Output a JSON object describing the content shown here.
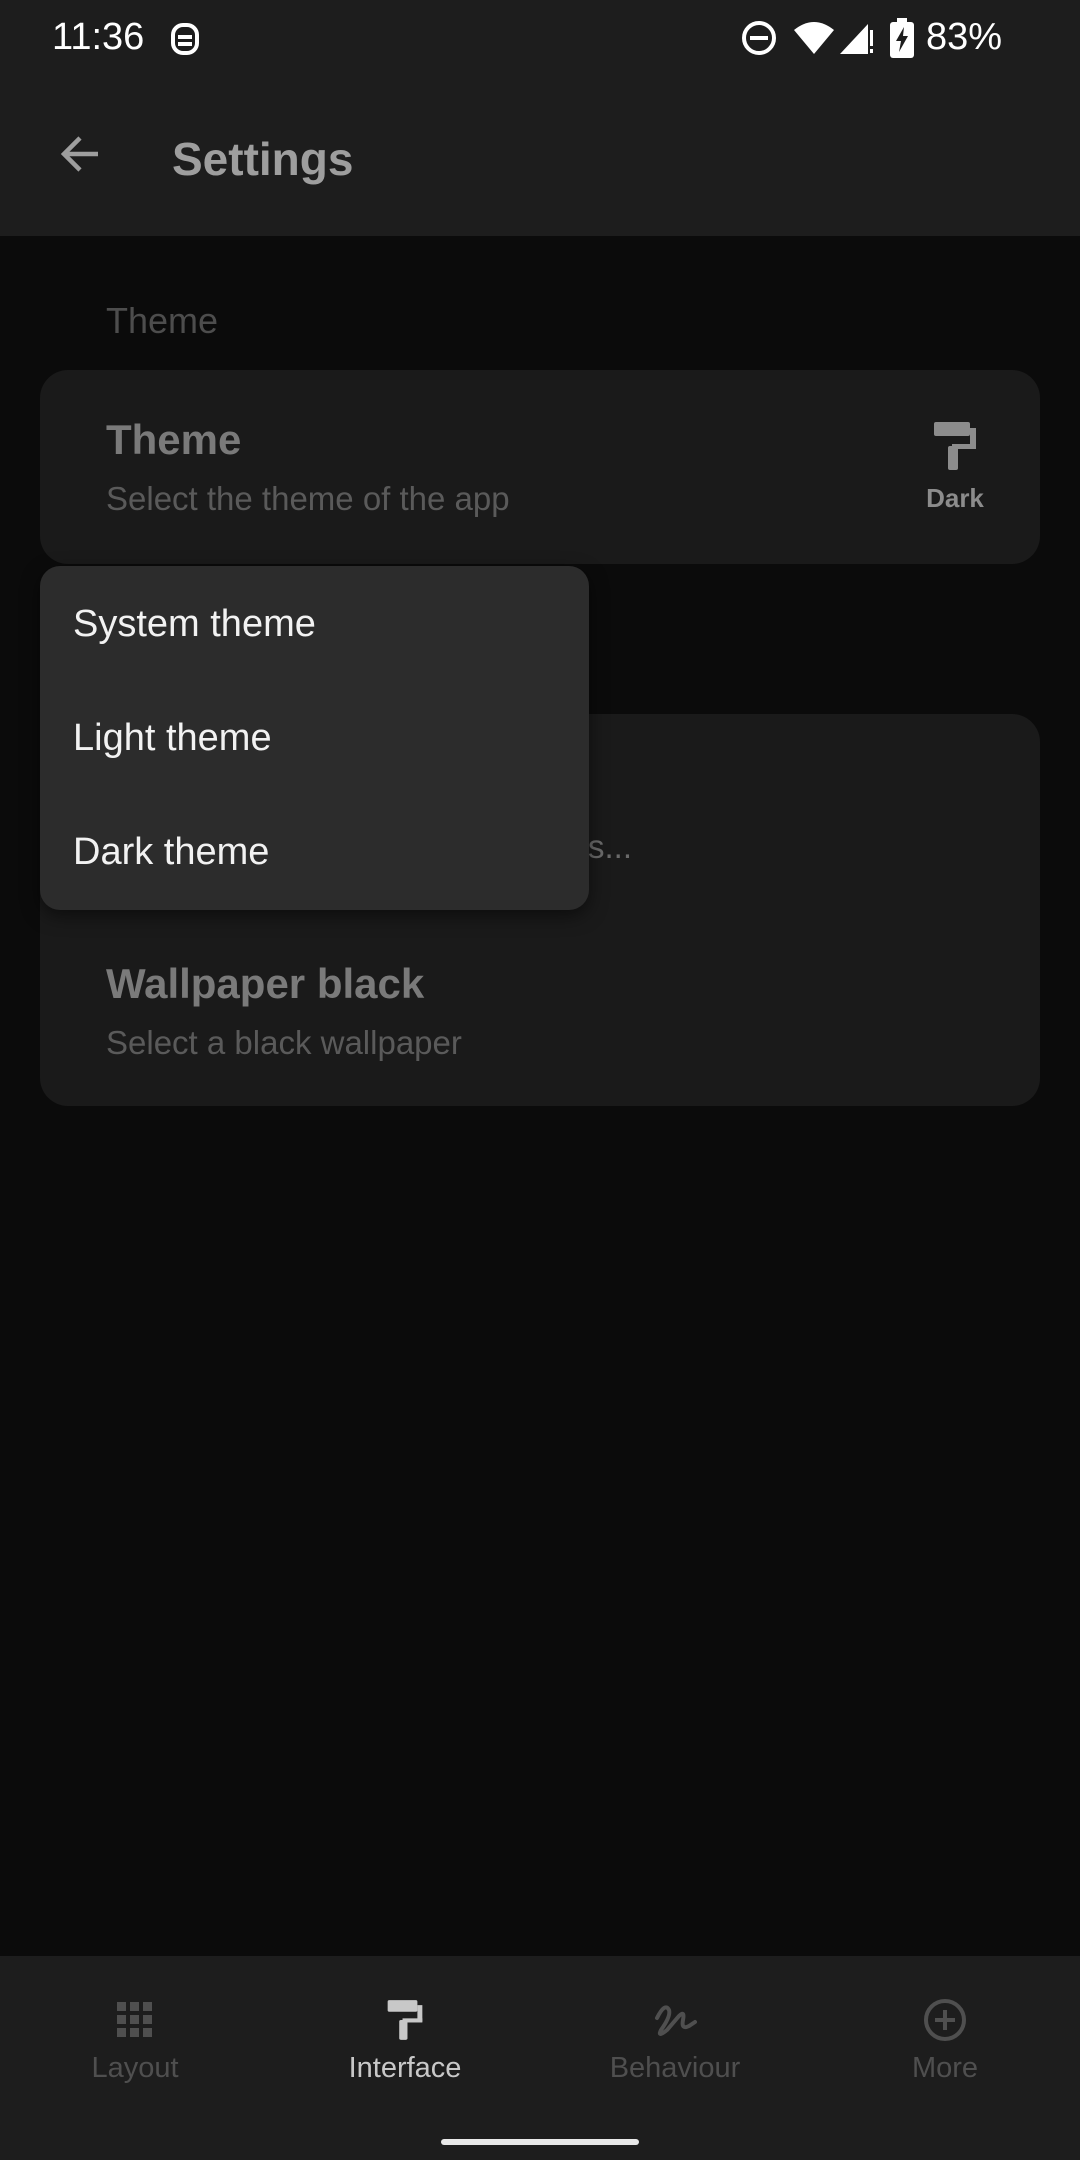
{
  "status_bar": {
    "time": "11:36",
    "battery": "83%",
    "icons": [
      "notification-icon",
      "dnd-icon",
      "wifi-icon",
      "signal-icon",
      "battery-charging-icon"
    ]
  },
  "app_bar": {
    "title": "Settings",
    "back_icon": "arrow-back-icon"
  },
  "section": {
    "header": "Theme"
  },
  "theme_pref": {
    "title": "Theme",
    "subtitle": "Select the theme of the app",
    "value_label": "Dark",
    "value_icon": "paint-roller-icon"
  },
  "hidden_pref": {
    "subtitle_tail": "s..."
  },
  "wallpaper_pref": {
    "title": "Wallpaper black",
    "subtitle": "Select a black wallpaper"
  },
  "theme_menu": {
    "items": [
      {
        "label": "System theme"
      },
      {
        "label": "Light theme"
      },
      {
        "label": "Dark theme"
      }
    ]
  },
  "bottom_nav": {
    "items": [
      {
        "label": "Layout",
        "icon": "grid-icon",
        "active": false
      },
      {
        "label": "Interface",
        "icon": "paint-roller-icon",
        "active": true
      },
      {
        "label": "Behaviour",
        "icon": "gesture-icon",
        "active": false
      },
      {
        "label": "More",
        "icon": "plus-circle-icon",
        "active": false
      }
    ]
  },
  "colors": {
    "background": "#0b0b0b",
    "bar": "#1d1d1d",
    "card": "#1a1a1a",
    "menu": "#2c2c2c"
  }
}
